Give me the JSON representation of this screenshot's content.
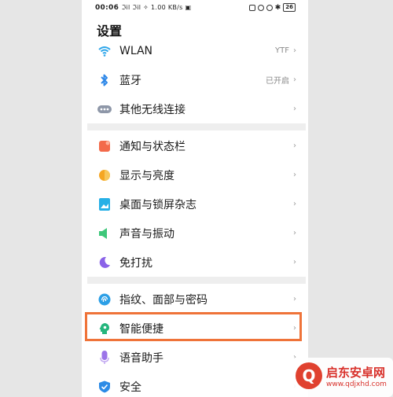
{
  "status_bar": {
    "time": "00:06",
    "signals": "ℑil ℑil ✧ 1.00 KB/s ▣",
    "battery": "26"
  },
  "page_title": "设置",
  "colors": {
    "highlight": "#ef7339",
    "group_separator": "#eeeeee"
  },
  "groups": [
    {
      "items": [
        {
          "label": "WLAN",
          "value": "YTF",
          "icon": "wifi-icon",
          "icon_color": "#2ea6ea"
        },
        {
          "label": "蓝牙",
          "value": "已开启",
          "icon": "bluetooth-icon",
          "icon_color": "#2f88e8"
        },
        {
          "label": "其他无线连接",
          "value": "",
          "icon": "link-icon",
          "icon_color": "#8e97a8"
        }
      ]
    },
    {
      "items": [
        {
          "label": "通知与状态栏",
          "value": "",
          "icon": "notification-icon",
          "icon_color": "#f36a4a"
        },
        {
          "label": "显示与亮度",
          "value": "",
          "icon": "brightness-icon",
          "icon_color": "#f5a623"
        },
        {
          "label": "桌面与锁屏杂志",
          "value": "",
          "icon": "wallpaper-icon",
          "icon_color": "#27b0e6"
        },
        {
          "label": "声音与振动",
          "value": "",
          "icon": "sound-icon",
          "icon_color": "#3ec77a"
        },
        {
          "label": "免打扰",
          "value": "",
          "icon": "moon-icon",
          "icon_color": "#8a62e8"
        }
      ]
    },
    {
      "items": [
        {
          "label": "指纹、面部与密码",
          "value": "",
          "icon": "fingerprint-icon",
          "icon_color": "#2c9fe6"
        },
        {
          "label": "智能便捷",
          "value": "",
          "icon": "smart-icon",
          "icon_color": "#25b67d"
        },
        {
          "label": "语音助手",
          "value": "",
          "icon": "voice-icon",
          "icon_color": "#9b73e8"
        },
        {
          "label": "安全",
          "value": "",
          "icon": "shield-icon",
          "icon_color": "#2c8be6"
        }
      ]
    }
  ],
  "chevron": "›",
  "watermark": {
    "title": "启东安卓网",
    "url": "www.qdjxhd.com",
    "logo_glyph": "Q"
  }
}
